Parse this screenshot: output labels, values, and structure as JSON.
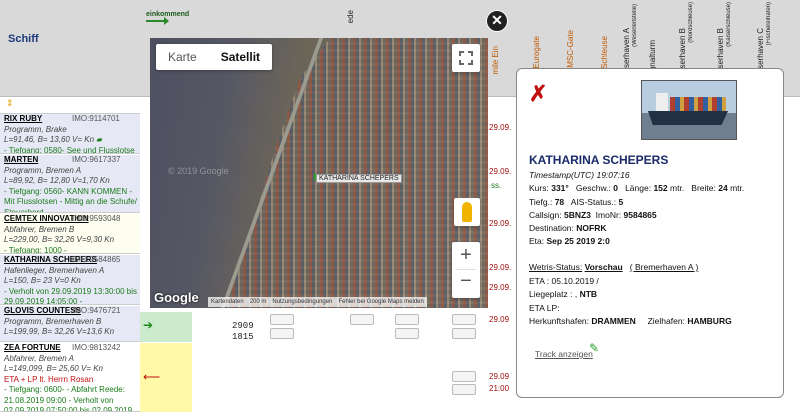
{
  "table": {
    "header_schiff": "Schiff",
    "einkommend": "einkommend",
    "column_labels": [
      "ede",
      "Eurogate",
      "MSC-Gate",
      "Schleuse",
      "Weserhaven A",
      "Signalturm",
      "Weserhaven B",
      "Weserhaven B",
      "Weserhaven C"
    ],
    "column_sublabels": [
      "(Weserleitstelle)",
      "(Nordschleuse)",
      "(Kaiserschleuse)",
      "(Fischereihafen)"
    ],
    "mile_label": "mile Ein",
    "rows": [
      {
        "name": "RIX RUBY",
        "imo": "IMO:9114701",
        "line1": "Programm, Brake",
        "line2": "L=91,46, B= 13,60   V= Kn",
        "line3": "- Tiefgang: 0580- See und Flusslotse"
      },
      {
        "name": "MARTEN",
        "imo": "IMO:9617337",
        "line1": "Programm, Bremen A",
        "line2": "L=89,92, B= 12,80   V=1,70 Kn",
        "line3": "- Tiefgang: 0560- KANN KOMMEN - Mit Flusslotsen - Mittig an die Schufe/ Steuerbord"
      },
      {
        "name": "CEMTEX INNOVATION",
        "imo": "IMO:9593048",
        "line1": "Abfahrer, Bremen B",
        "line2": "L=229,00, B= 32,26   V=9,30 Kn",
        "line3": "- Tiefgang: 1000 -"
      },
      {
        "name": "KATHARINA SCHEPERS",
        "imo": "IMO:9584865",
        "line1": "Hafenlieger, Bremerhaven A",
        "line2": "L=150, B= 23   V=0 Kn",
        "line3": "- Verholt von 29.09.2019 13:30:00 bis 29.09.2019 14:05:00 -"
      },
      {
        "name": "GLOVIS COUNTESS",
        "imo": "IMO:9476721",
        "line1": "Programm, Bremerhaven B",
        "line2": "L=199,99, B= 32,26   V=13,6 Kn"
      },
      {
        "name": "ZEA FORTUNE",
        "imo": "IMO:9813242",
        "line1": "Abfahrer, Bremen A",
        "line2": "L=149,099, B= 25,60   V= Kn",
        "line3": "ETA + LP lt. Herrn Rosan",
        "line4": "- Tiefgang: 0600- - Abfahrt Reede: 21.08.2019 09:00 - Verholt von 02.09.2019 07:50:00 bis 02.09.2019"
      }
    ],
    "times": [
      "2909",
      "1815"
    ],
    "dates_right": [
      "29.09",
      "29.09",
      "21:00"
    ],
    "dates_right_upper": [
      "29.09.",
      "29.09.",
      "29.09.",
      "29.09.",
      "29.09."
    ],
    "small_right": [
      "ss."
    ]
  },
  "map": {
    "btn_karte": "Karte",
    "btn_satellit": "Satellit",
    "ship_label": "KATHARINA SCHEPERS",
    "watermark": "© 2019 Google",
    "google_logo": "Google",
    "attribution": [
      "Kartendaten",
      "200 m",
      "Nutzungsbedingungen",
      "Fehler bei Google Maps melden"
    ],
    "zoom_in": "+",
    "zoom_out": "−",
    "close": "✕"
  },
  "info": {
    "title": "KATHARINA SCHEPERS",
    "timestamp_label": "Timestamp",
    "timestamp_value": "(UTC) 19:07:16",
    "kurs_label": "Kurs:",
    "kurs_value": "331°",
    "geschw_label": "Geschw.:",
    "geschw_value": "0",
    "laenge_label": "Länge:",
    "laenge_value": "152",
    "laenge_unit": "mtr.",
    "breite_label": "Breite:",
    "breite_value": "24",
    "breite_unit": "mtr.",
    "tiefg_label": "Tiefg.:",
    "tiefg_value": "78",
    "ais_label": "AIS-Status.:",
    "ais_value": "5",
    "callsign_label": "Callsign:",
    "callsign_value": "5BNZ3",
    "imonr_label": "ImoNr:",
    "imonr_value": "9584865",
    "destination_label": "Destination:",
    "destination_value": "NOFRK",
    "eta_label": "Eta:",
    "eta_value": "Sep 25 2019 2:0",
    "wetris_label": "Wetris-Status:",
    "wetris_value": "Vorschau",
    "wetris_place": "( Bremerhaven A )",
    "eta2_label": "ETA :",
    "eta2_value": "05.10.2019 /",
    "liegeplatz_label": "Liegeplatz : ,",
    "liegeplatz_value": "NTB",
    "etalp_label": "ETA LP:",
    "herkunft_label": "Herkunftshafen:",
    "herkunft_value": "DRAMMEN",
    "ziel_label": "Zielhafen:",
    "ziel_value": "HAMBURG",
    "track_link": "Track anzeigen"
  }
}
